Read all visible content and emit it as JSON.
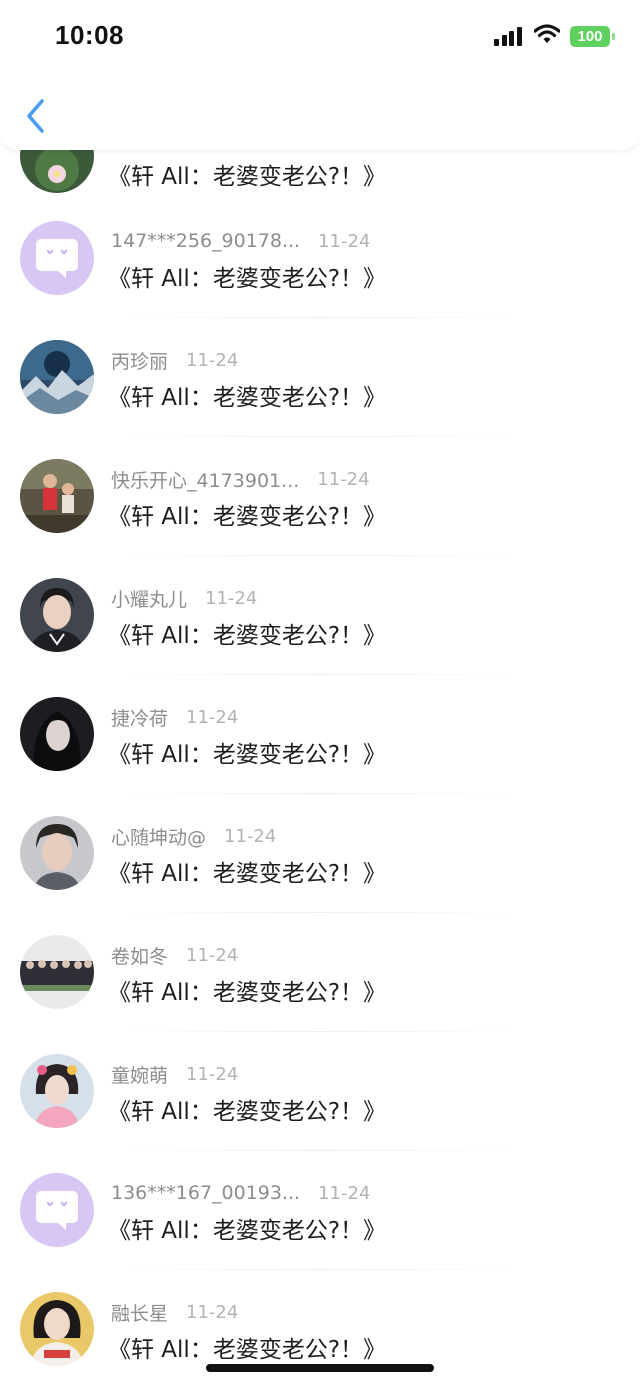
{
  "status_bar": {
    "time": "10:08",
    "battery": "100"
  },
  "comments": [
    {
      "name": "",
      "date": "",
      "title": "《轩 All：老婆变老公?！》",
      "avatar": "flower-avatar"
    },
    {
      "name": "147***256_90178...",
      "date": "11-24",
      "title": "《轩 All：老婆变老公?！》",
      "avatar": "default-chat-avatar"
    },
    {
      "name": "丙珍丽",
      "date": "11-24",
      "title": "《轩 All：老婆变老公?！》",
      "avatar": "mountain-planet-avatar"
    },
    {
      "name": "快乐开心_4173901...",
      "date": "11-24",
      "title": "《轩 All：老婆变老公?！》",
      "avatar": "kids-outdoor-avatar"
    },
    {
      "name": "小耀丸儿",
      "date": "11-24",
      "title": "《轩 All：老婆变老公?！》",
      "avatar": "young-man-avatar"
    },
    {
      "name": "捷冷荷",
      "date": "11-24",
      "title": "《轩 All：老婆变老公?！》",
      "avatar": "dark-hair-girl-avatar"
    },
    {
      "name": "心随坤动@",
      "date": "11-24",
      "title": "《轩 All：老婆变老公?！》",
      "avatar": "portrait-man-avatar"
    },
    {
      "name": "卷如冬",
      "date": "11-24",
      "title": "《轩 All：老婆变老公?！》",
      "avatar": "group-photo-avatar"
    },
    {
      "name": "童婉萌",
      "date": "11-24",
      "title": "《轩 All：老婆变老公?！》",
      "avatar": "costume-girl-avatar"
    },
    {
      "name": "136***167_00193...",
      "date": "11-24",
      "title": "《轩 All：老婆变老公?！》",
      "avatar": "default-chat-avatar"
    },
    {
      "name": "融长星",
      "date": "11-24",
      "title": "《轩 All：老婆变老公?！》",
      "avatar": "girl-red-shirt-avatar"
    }
  ],
  "colors": {
    "default_avatar_bg": "#d8c7f5",
    "name_text": "#8d8d8d",
    "date_text": "#b3b3b3",
    "title_text": "#1e1e1e",
    "back_arrow": "#4a9cf0",
    "battery": "#5fd15f"
  }
}
